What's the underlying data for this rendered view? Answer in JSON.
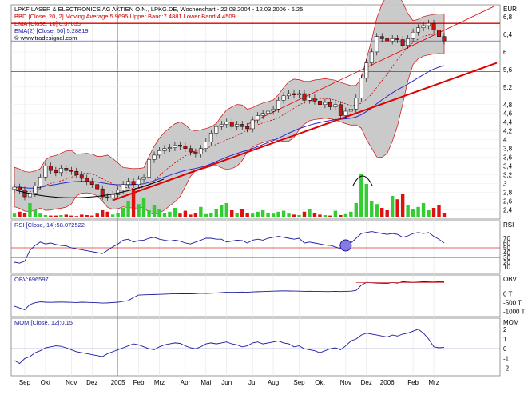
{
  "chart_data": [
    {
      "type": "candlestick",
      "currency": "EUR",
      "header_lines": [
        {
          "text": "LPKF LASER & ELECTRONICS AG AKTIEN O.N., LPKG.DE, Wochenchart - 22.08.2004 - 12.03.2006 - 6.25",
          "color": "#000000"
        },
        {
          "text": "BBD [Close, 20, 2] Moving Average:5.9695 Upper Band:7.4881 Lower Band:4.4509",
          "color": "#cc0000"
        },
        {
          "text": "EMA [Close, 10]:6.37635",
          "color": "#cc0000"
        },
        {
          "text": "EMA(2) [Close, 50]:5.28819",
          "color": "#1a1aa0"
        }
      ],
      "source_note": "© www.tradesignal.com",
      "y_ticks": [
        "6,8",
        "6,4",
        "6",
        "5,6",
        "5,2",
        "4,8",
        "4,6",
        "4,4",
        "4,2",
        "4",
        "3,8",
        "3,6",
        "3,4",
        "3,2",
        "3",
        "2,8",
        "2,6",
        "2,4"
      ],
      "close_series": [
        2.92,
        2.85,
        2.7,
        2.78,
        2.95,
        3.15,
        3.4,
        3.3,
        3.25,
        3.35,
        3.3,
        3.28,
        3.2,
        3.12,
        3.05,
        2.98,
        2.88,
        2.7,
        2.68,
        2.75,
        2.85,
        2.98,
        3.05,
        2.98,
        3.1,
        3.15,
        3.55,
        3.65,
        3.75,
        3.8,
        3.82,
        3.88,
        3.85,
        3.8,
        3.72,
        3.68,
        3.8,
        3.95,
        4.15,
        4.3,
        4.35,
        4.4,
        4.3,
        4.35,
        4.3,
        4.25,
        4.45,
        4.55,
        4.6,
        4.65,
        4.7,
        4.9,
        5.0,
        5.05,
        5.02,
        5.05,
        4.9,
        4.95,
        4.88,
        4.8,
        4.85,
        4.75,
        4.8,
        4.55,
        4.65,
        4.7,
        4.95,
        5.4,
        5.75,
        6.0,
        6.35,
        6.3,
        6.25,
        6.3,
        6.28,
        6.15,
        6.3,
        6.45,
        6.55,
        6.6,
        6.65,
        6.5,
        6.35,
        6.25
      ],
      "volume_bars": [
        0.08,
        0.12,
        0.1,
        0.3,
        0.15,
        0.08,
        0.05,
        0.04,
        0.04,
        0.05,
        0.06,
        0.04,
        0.03,
        0.06,
        0.05,
        0.04,
        0.08,
        0.15,
        0.12,
        0.06,
        0.1,
        0.2,
        0.35,
        0.6,
        0.28,
        0.4,
        0.15,
        0.25,
        0.18,
        0.1,
        0.12,
        0.2,
        0.08,
        0.14,
        0.06,
        0.1,
        0.22,
        0.07,
        0.1,
        0.18,
        0.25,
        0.3,
        0.15,
        0.1,
        0.18,
        0.1,
        0.08,
        0.12,
        0.15,
        0.1,
        0.08,
        0.12,
        0.14,
        0.08,
        0.06,
        0.05,
        0.12,
        0.18,
        0.09,
        0.06,
        0.05,
        0.04,
        0.14,
        0.05,
        0.07,
        0.12,
        0.3,
        0.9,
        0.7,
        0.35,
        0.28,
        0.2,
        0.15,
        0.45,
        0.38,
        0.5,
        0.25,
        0.18,
        0.22,
        0.3,
        0.15,
        0.2,
        0.25,
        0.1
      ],
      "horizontal_lines": [
        6.65,
        6.25,
        5.55
      ],
      "x_labels": [
        "Sep",
        "Okt",
        "Nov",
        "Dez",
        "2005",
        "Feb",
        "Mrz",
        "Apr",
        "Mai",
        "Jun",
        "Jul",
        "Aug",
        "Sep",
        "Okt",
        "Nov",
        "Dez",
        "2006",
        "Feb",
        "Mrz"
      ]
    },
    {
      "type": "line",
      "title": "RSI [Close, 14]:58.072522",
      "panel_tag": "RSI",
      "y_ticks": [
        "70",
        "60",
        "50",
        "40",
        "30",
        "20",
        "10"
      ],
      "levels": [
        50,
        30
      ],
      "ylim": [
        0,
        100
      ],
      "values": [
        20,
        18,
        22,
        45,
        55,
        62,
        58,
        60,
        57,
        55,
        54,
        50,
        48,
        46,
        44,
        42,
        40,
        38,
        45,
        52,
        58,
        66,
        68,
        62,
        65,
        66,
        70,
        72,
        68,
        66,
        64,
        66,
        64,
        60,
        58,
        62,
        66,
        70,
        70,
        68,
        68,
        62,
        64,
        66,
        65,
        60,
        66,
        68,
        66,
        70,
        72,
        74,
        72,
        70,
        68,
        70,
        60,
        62,
        60,
        58,
        56,
        55,
        52,
        48,
        55,
        60,
        70,
        80,
        82,
        84,
        82,
        80,
        78,
        80,
        78,
        72,
        75,
        80,
        82,
        80,
        82,
        74,
        68,
        60
      ],
      "highlight_index": 64
    },
    {
      "type": "line",
      "title": "OBV:696597",
      "panel_tag": "OBV",
      "y_ticks": [
        "0 T",
        "-500 T",
        "-1000 T"
      ],
      "ylim": [
        -1200,
        900
      ],
      "values": [
        -700,
        -800,
        -900,
        -600,
        -500,
        -450,
        -470,
        -480,
        -470,
        -460,
        -470,
        -480,
        -490,
        -470,
        -480,
        -490,
        -500,
        -520,
        -510,
        -490,
        -470,
        -420,
        -380,
        -200,
        -60,
        -50,
        -40,
        -30,
        -20,
        -10,
        0,
        20,
        10,
        15,
        10,
        20,
        40,
        30,
        40,
        60,
        80,
        100,
        90,
        100,
        110,
        100,
        120,
        130,
        140,
        150,
        160,
        170,
        180,
        170,
        165,
        160,
        150,
        155,
        150,
        145,
        140,
        138,
        150,
        140,
        150,
        160,
        200,
        500,
        660,
        640,
        620,
        610,
        600,
        650,
        620,
        700,
        680,
        660,
        680,
        700,
        690,
        680,
        700,
        696
      ]
    },
    {
      "type": "line",
      "title": "MOM [Close, 12]:0.15",
      "panel_tag": "MOM",
      "y_ticks": [
        "2",
        "1",
        "0",
        "-1",
        "-2"
      ],
      "level": 0,
      "ylim": [
        -2.6,
        2.8
      ],
      "values": [
        -1.2,
        -1.5,
        -1.0,
        -0.8,
        -0.4,
        -0.2,
        0.1,
        0.2,
        0.3,
        0.25,
        0.1,
        -0.1,
        -0.3,
        -0.4,
        -0.5,
        -0.6,
        -0.7,
        -0.8,
        -0.5,
        -0.3,
        -0.1,
        0.1,
        0.3,
        0.5,
        0.4,
        0.2,
        0.0,
        -0.1,
        0.2,
        0.4,
        0.5,
        0.6,
        0.55,
        0.3,
        0.1,
        0.0,
        0.2,
        0.5,
        0.6,
        0.5,
        0.6,
        0.7,
        0.5,
        0.4,
        0.2,
        0.3,
        0.6,
        0.7,
        0.5,
        0.6,
        0.7,
        0.8,
        0.6,
        0.5,
        0.2,
        0.3,
        0.0,
        -0.1,
        -0.2,
        -0.4,
        -0.2,
        0.0,
        0.1,
        -0.1,
        0.3,
        0.8,
        1.0,
        1.4,
        1.6,
        1.5,
        1.4,
        1.3,
        1.2,
        1.4,
        1.3,
        1.5,
        1.6,
        1.8,
        2.0,
        1.6,
        1.0,
        0.2,
        0.1,
        0.15
      ]
    }
  ]
}
